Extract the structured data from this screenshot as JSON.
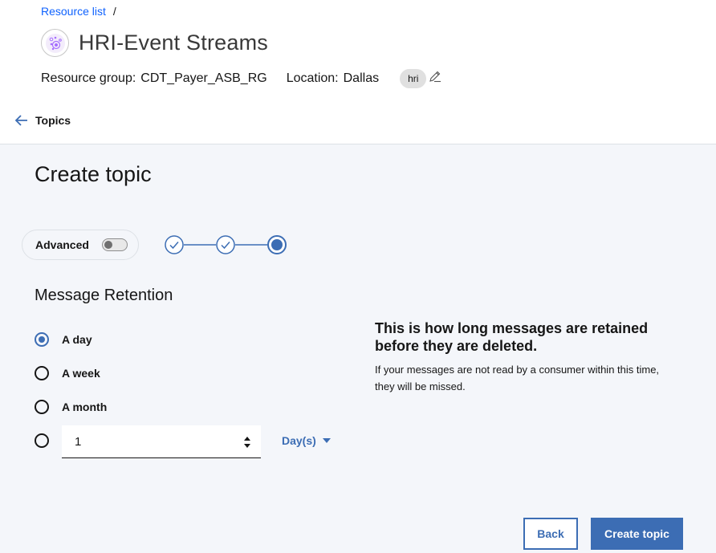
{
  "breadcrumb": {
    "link": "Resource list",
    "separator": "/"
  },
  "service": {
    "title": "HRI-Event Streams",
    "icon": "event-streams-icon"
  },
  "meta": {
    "resource_group_label": "Resource group:",
    "resource_group_value": "CDT_Payer_ASB_RG",
    "location_label": "Location:",
    "location_value": "Dallas",
    "tag": "hri"
  },
  "nav": {
    "back_label": "Topics"
  },
  "form": {
    "title": "Create topic",
    "advanced_label": "Advanced",
    "advanced_enabled": false,
    "steps": [
      {
        "state": "complete"
      },
      {
        "state": "complete"
      },
      {
        "state": "current"
      }
    ],
    "section_title": "Message Retention",
    "options": [
      {
        "label": "A day",
        "selected": true
      },
      {
        "label": "A week",
        "selected": false
      },
      {
        "label": "A month",
        "selected": false
      },
      {
        "label": "",
        "selected": false
      }
    ],
    "custom_value": "1",
    "unit_label": "Day(s)",
    "help_title": "This is how long messages are retained before they are deleted.",
    "help_text": "If your messages are not read by a consumer within this time, they will be missed."
  },
  "actions": {
    "back_label": "Back",
    "create_label": "Create topic"
  },
  "colors": {
    "accent": "#3c6db4",
    "link": "#0f62fe",
    "panel_bg": "#f4f6fa"
  }
}
